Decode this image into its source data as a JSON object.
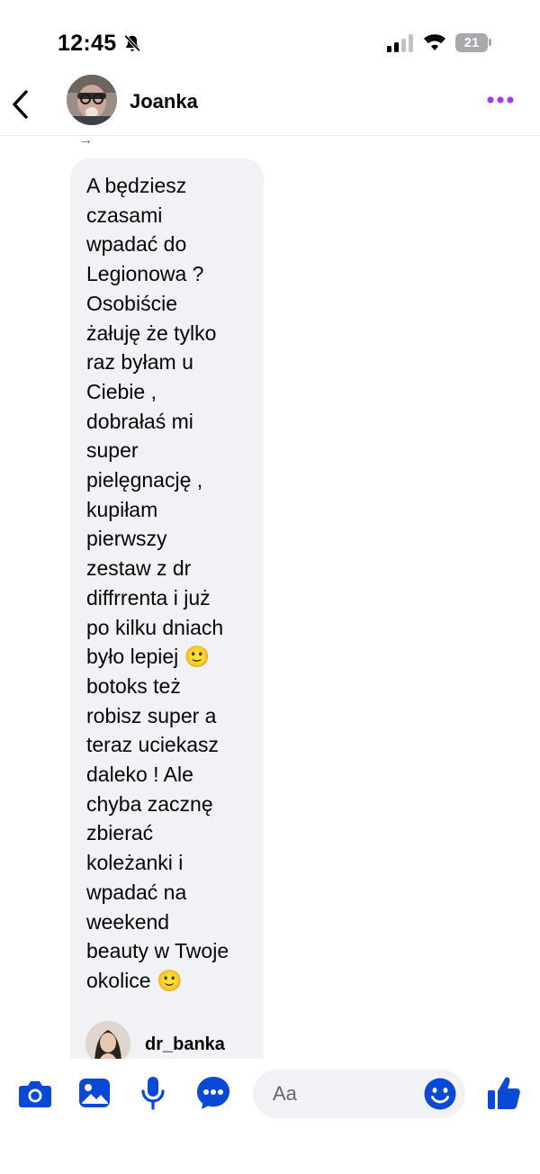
{
  "status_bar": {
    "time": "12:45",
    "battery": "21",
    "icons": [
      "bell-slash-icon",
      "cellular-signal-icon",
      "wifi-icon",
      "battery-icon"
    ]
  },
  "header": {
    "contact_name": "Joanka",
    "icons": [
      "back-arrow-icon",
      "more-options-icon"
    ]
  },
  "conversation": {
    "forwarded_icon": "→",
    "message_text": "A będziesz\nczasami\nwpadać do\nLegionowa ?\nOsobiście\nżałuję że tylko\nraz byłam u\nCiebie ,\ndobrałaś mi\nsuper\npielęgnację ,\nkupiłam\npierwszy\nzestaw z dr\ndiffrrenta i już\npo kilku dniach\nbyło lepiej 🙂\nbotoks też\nrobisz super a\nteraz uciekasz\ndaleko ! Ale\nchyba zacznę\nzbierać\nkoleżanki i\nwpadać na\nweekend\nbeauty w Twoje\nokolice 🙂",
    "shared_account": "dr_banka"
  },
  "composer": {
    "placeholder": "Aa",
    "icons": [
      "camera-icon",
      "gallery-icon",
      "microphone-icon",
      "more-actions-icon",
      "emoji-icon",
      "thumbs-up-icon"
    ]
  },
  "colors": {
    "accent": "#0a49d6",
    "menu_dots": "#a33ef0",
    "bubble_bg": "#f0f2f5",
    "input_bg": "#f0f2f5"
  }
}
